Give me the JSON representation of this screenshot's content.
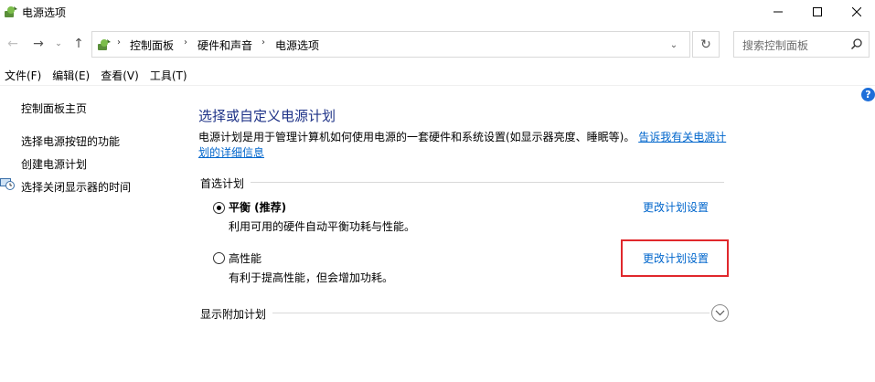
{
  "window": {
    "title": "电源选项",
    "minimize_glyph": "—",
    "maximize_glyph": "☐",
    "close_glyph": "✕"
  },
  "nav": {
    "back_glyph": "←",
    "forward_glyph": "→",
    "recent_glyph": "⌄",
    "up_glyph": "↑",
    "breadcrumbs": [
      "控制面板",
      "硬件和声音",
      "电源选项"
    ],
    "separator_glyph": "›",
    "dropdown_glyph": "⌄",
    "refresh_glyph": "↻",
    "search_placeholder": "搜索控制面板"
  },
  "menu": {
    "items": [
      "文件(F)",
      "编辑(E)",
      "查看(V)",
      "工具(T)"
    ]
  },
  "help": {
    "glyph": "?"
  },
  "sidebar": {
    "items": [
      {
        "label": "控制面板主页"
      },
      {
        "label": "选择电源按钮的功能"
      },
      {
        "label": "创建电源计划"
      },
      {
        "label": "选择关闭显示器的时间"
      }
    ]
  },
  "main": {
    "title": "选择或自定义电源计划",
    "description": "电源计划是用于管理计算机如何使用电源的一套硬件和系统设置(如显示器亮度、睡眠等)。",
    "description_link": "告诉我有关电源计划的详细信息",
    "preferred_header": "首选计划",
    "plans": [
      {
        "name": "平衡 (推荐)",
        "description": "利用可用的硬件自动平衡功耗与性能。",
        "link": "更改计划设置",
        "selected": true
      },
      {
        "name": "高性能",
        "description": "有利于提高性能，但会增加功耗。",
        "link": "更改计划设置",
        "selected": false
      }
    ],
    "additional_header": "显示附加计划"
  },
  "colors": {
    "title_blue": "#1e3287",
    "link_blue": "#0066cc",
    "highlight_red": "#e0282c"
  }
}
